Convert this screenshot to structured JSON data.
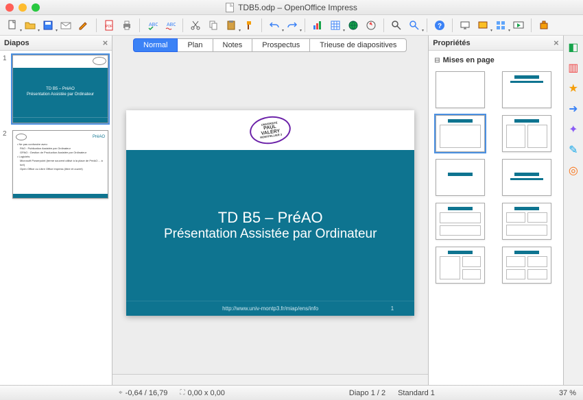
{
  "window": {
    "title": "TDB5.odp – OpenOffice Impress"
  },
  "panels": {
    "slides_title": "Diapos",
    "props_title": "Propriétés",
    "layouts_title": "Mises en page"
  },
  "viewtabs": {
    "normal": "Normal",
    "plan": "Plan",
    "notes": "Notes",
    "prospectus": "Prospectus",
    "sorter": "Trieuse de diapositives"
  },
  "slide1": {
    "title": "TD B5 – PréAO",
    "subtitle": "Présentation Assistée par Ordinateur",
    "footer": "http://www.univ-montp3.fr/miap/ens/info",
    "pagenum": "1",
    "logo_top": "UNIVERSITÉ",
    "logo_mid1": "PAUL",
    "logo_mid2": "VALÉRY",
    "logo_bot": "MONTPELLIER 3"
  },
  "slide2": {
    "title": "PréAO",
    "b1": "• Ne pas confondre avec:",
    "b1a": "PAO : Publication Assistée par Ordinateur",
    "b1b": "GPAO : Gestion de Production Assistée par Ordinateur",
    "b2": "• Logiciels:",
    "b2a": "Microsoft Powerpoint (terme souvent utilisé à la place de PréAO… à tort)",
    "b2b": "Open Office ou Libre Office Impress (libre et ouvert)"
  },
  "thumbs": {
    "n1": "1",
    "n2": "2"
  },
  "status": {
    "coords": "-0,64 / 16,79",
    "size": "0,00 x 0,00",
    "slide": "Diapo 1 / 2",
    "template": "Standard 1",
    "zoom": "37 %"
  },
  "icons": {
    "new": "new-doc",
    "open": "open",
    "save": "save",
    "mail": "mail",
    "pdf": "export-pdf",
    "print": "print",
    "spell": "spellcheck",
    "abc": "autospell",
    "cut": "cut",
    "copy": "copy",
    "paste": "paste",
    "brush": "format-brush",
    "undo": "undo",
    "redo": "redo",
    "chart": "chart",
    "table": "table",
    "link": "hyperlink",
    "nav": "navigator",
    "zoom": "zoom",
    "help": "help",
    "presentation": "presentation",
    "slide_design": "slide-design",
    "slide_show": "slideshow",
    "sb_props": "properties",
    "sb_gallery": "gallery",
    "sb_styles": "styles",
    "sb_nav": "navigator",
    "sb_anim": "animation",
    "sb_trans": "transition",
    "sb_master": "master"
  }
}
